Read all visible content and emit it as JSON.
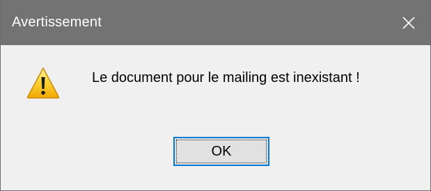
{
  "dialog": {
    "title": "Avertissement",
    "message": "Le document pour le mailing est inexistant !",
    "ok_label": "OK",
    "icons": {
      "close": "close-icon",
      "warning": "warning-icon"
    }
  },
  "colors": {
    "titlebar": "#737373",
    "title_text": "#ffffff",
    "body": "#f0f0f0",
    "button_border": "#0078d7",
    "button_bg": "#e1e1e1"
  }
}
